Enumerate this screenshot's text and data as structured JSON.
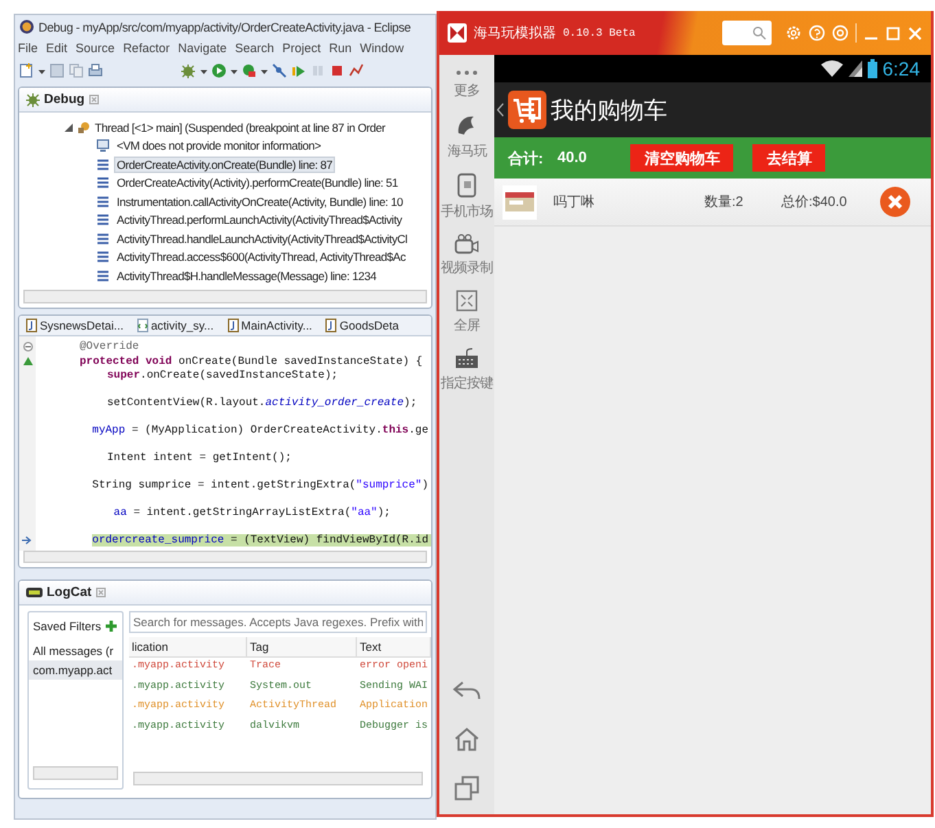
{
  "eclipse": {
    "title": "Debug - myApp/src/com/myapp/activity/OrderCreateActivity.java - Eclipse",
    "menu": [
      "File",
      "Edit",
      "Source",
      "Refactor",
      "Navigate",
      "Search",
      "Project",
      "Run",
      "Window"
    ],
    "debug_view": {
      "tab": "Debug",
      "thread": {
        "label": "Thread [<1> main] (Suspended (breakpoint at line 87 in Order",
        "expanded": true
      },
      "frames": [
        {
          "kind": "monitor",
          "text": "<VM does not provide monitor information>",
          "selected": false
        },
        {
          "kind": "frame",
          "text": "OrderCreateActivity.onCreate(Bundle) line: 87",
          "selected": true
        },
        {
          "kind": "frame",
          "text": "OrderCreateActivity(Activity).performCreate(Bundle) line: 51",
          "selected": false
        },
        {
          "kind": "frame",
          "text": "Instrumentation.callActivityOnCreate(Activity, Bundle) line: 10",
          "selected": false
        },
        {
          "kind": "frame",
          "text": "ActivityThread.performLaunchActivity(ActivityThread$Activity",
          "selected": false
        },
        {
          "kind": "frame",
          "text": "ActivityThread.handleLaunchActivity(ActivityThread$ActivityCl",
          "selected": false
        },
        {
          "kind": "frame",
          "text": "ActivityThread.access$600(ActivityThread, ActivityThread$Ac",
          "selected": false
        },
        {
          "kind": "frame",
          "text": "ActivityThread$H.handleMessage(Message) line: 1234",
          "selected": false
        }
      ]
    },
    "editor": {
      "tabs": [
        {
          "label": "SysnewsDetai...",
          "kind": "java"
        },
        {
          "label": "activity_sy...",
          "kind": "xml"
        },
        {
          "label": "MainActivity...",
          "kind": "java"
        },
        {
          "label": "GoodsDeta",
          "kind": "java"
        }
      ],
      "lines": [
        {
          "kind": "fold",
          "spaced": false,
          "highlighted": false,
          "segments": [
            {
              "kind": "annotation",
              "text": "@Override"
            }
          ]
        },
        {
          "kind": "override",
          "spaced": false,
          "highlighted": false,
          "segments": [
            {
              "kind": "keyword",
              "text": "protected void"
            },
            {
              "kind": "plain",
              "text": " onCreate(Bundle savedInstanceState) {"
            }
          ],
          "children": [
            {
              "kind": "plain",
              "spaced": false,
              "highlighted": false,
              "segments": [
                {
                  "kind": "keyword",
                  "text": "super"
                },
                {
                  "kind": "plain",
                  "text": ".onCreate(savedInstanceState);"
                }
              ]
            },
            {
              "kind": "plain",
              "spaced": true,
              "highlighted": false,
              "segments": [
                {
                  "kind": "plain",
                  "text": "setContentView(R.layout."
                },
                {
                  "kind": "static",
                  "text": "activity_order_create"
                },
                {
                  "kind": "plain",
                  "text": ");"
                }
              ]
            },
            {
              "kind": "plain",
              "spaced": true,
              "highlighted": false,
              "segments": [
                {
                  "kind": "field",
                  "text": "myApp"
                },
                {
                  "kind": "plain",
                  "text": " = (MyApplication) OrderCreateActivity."
                },
                {
                  "kind": "keyword",
                  "text": "this"
                },
                {
                  "kind": "plain",
                  "text": ".ge"
                }
              ]
            },
            {
              "kind": "plain",
              "spaced": true,
              "highlighted": false,
              "segments": [
                {
                  "kind": "plain",
                  "text": "Intent intent = getIntent();"
                }
              ]
            },
            {
              "kind": "plain",
              "spaced": true,
              "highlighted": false,
              "segments": [
                {
                  "kind": "plain",
                  "text": "String sumprice = intent.getStringExtra("
                },
                {
                  "kind": "string",
                  "text": "\"sumprice\""
                },
                {
                  "kind": "plain",
                  "text": ")"
                }
              ]
            },
            {
              "kind": "plain",
              "spaced": true,
              "highlighted": false,
              "segments": [
                {
                  "kind": "field",
                  "text": " aa"
                },
                {
                  "kind": "plain",
                  "text": " = intent.getStringArrayListExtra("
                },
                {
                  "kind": "string",
                  "text": "\"aa\""
                },
                {
                  "kind": "plain",
                  "text": ");"
                }
              ]
            },
            {
              "kind": "debug",
              "spaced": true,
              "highlighted": true,
              "segments": [
                {
                  "kind": "field",
                  "text": "ordercreate_sumprice"
                },
                {
                  "kind": "plain",
                  "text": " = (TextView) findViewById(R.id"
                }
              ]
            }
          ]
        }
      ]
    },
    "logcat": {
      "tab": "LogCat",
      "filters_title": "Saved Filters",
      "filters": [
        {
          "label": "All messages (r",
          "selected": false
        },
        {
          "label": "com.myapp.act",
          "selected": true
        }
      ],
      "search": {
        "placeholder": "Search for messages. Accepts Java regexes. Prefix with"
      },
      "columns": [
        "lication",
        "Tag",
        "Text"
      ],
      "rows": [
        {
          "color": "#d04a3c",
          "cells": [
            ".myapp.activity",
            "Trace",
            "error openi"
          ]
        },
        {
          "color": "#3d7a3d",
          "cells": [
            ".myapp.activity",
            "System.out",
            "Sending WAI"
          ]
        },
        {
          "color": "#e0912a",
          "cells": [
            ".myapp.activity",
            "ActivityThread",
            "Application"
          ]
        },
        {
          "color": "#3d7a3d",
          "cells": [
            ".myapp.activity",
            "dalvikvm",
            "Debugger is"
          ]
        }
      ]
    }
  },
  "emulator": {
    "title": "海马玩模拟器",
    "version": "0.10.3 Beta",
    "sidebar": [
      {
        "kind": "more",
        "label": "更多"
      },
      {
        "kind": "app",
        "label": "海马玩"
      },
      {
        "kind": "market",
        "label": "手机市场"
      },
      {
        "kind": "record",
        "label": "视频录制"
      },
      {
        "kind": "fullscreen",
        "label": "全屏"
      },
      {
        "kind": "keys",
        "label": "指定按键"
      }
    ],
    "status_bar": {
      "time": "6:24"
    },
    "app": {
      "title": "我的购物车",
      "total_label": "合计:",
      "total": "40.0",
      "buttons": [
        "清空购物车",
        "去结算"
      ],
      "items": [
        {
          "name": "吗丁啉",
          "quantity": "数量:2",
          "price": "总价:$40.0"
        }
      ]
    }
  }
}
